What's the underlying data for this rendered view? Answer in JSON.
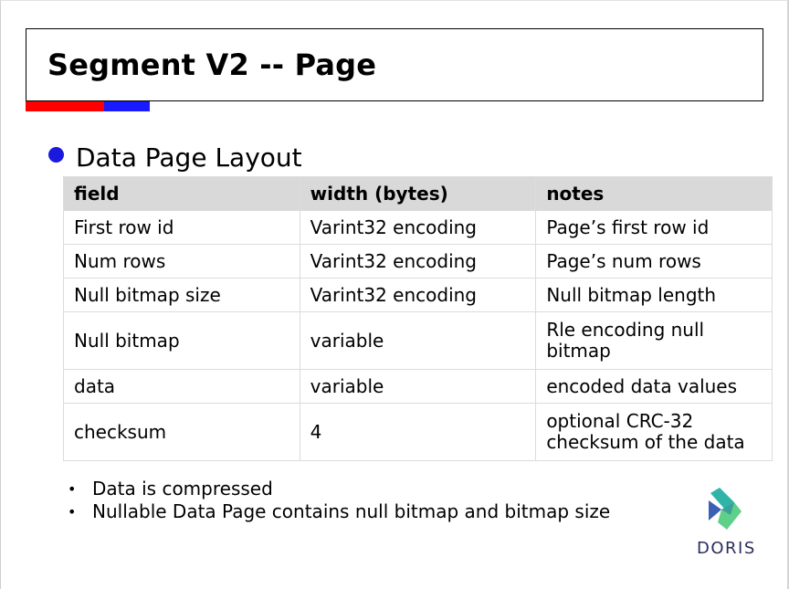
{
  "slide": {
    "title": "Segment V2 -- Page",
    "section_heading": "Data Page Layout"
  },
  "table": {
    "headers": [
      "field",
      "width (bytes)",
      "notes"
    ],
    "rows": [
      [
        "First row id",
        "Varint32 encoding",
        "Page’s first row id"
      ],
      [
        "Num rows",
        "Varint32 encoding",
        "Page’s num rows"
      ],
      [
        "Null bitmap size",
        "Varint32 encoding",
        "Null bitmap length"
      ],
      [
        "Null bitmap",
        "variable",
        "Rle encoding null bitmap"
      ],
      [
        "data",
        "variable",
        "encoded data values"
      ],
      [
        "checksum",
        "4",
        "optional CRC-32 checksum of the data"
      ]
    ]
  },
  "notes": [
    "Data is compressed",
    "Nullable Data Page contains null bitmap and bitmap size"
  ],
  "bullet_glyph": "•",
  "logo": {
    "text": "DORIS",
    "colors": {
      "blue": "#3b5fb5",
      "teal": "#2fb5a8",
      "green": "#5fd08a",
      "text": "#2a2d5e"
    }
  },
  "colors": {
    "accent_red": "#ff0000",
    "accent_blue": "#1a1aff",
    "header_fill": "#d9d9d9",
    "bullet_blue": "#1a1adf"
  }
}
